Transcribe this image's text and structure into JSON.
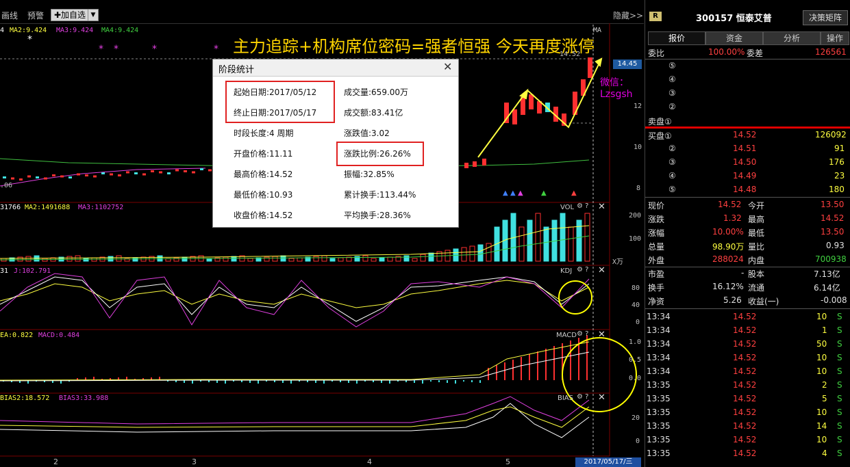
{
  "toolbar": {
    "draw_label": "画线",
    "alert_label": "预警",
    "add_watch_label": "✚加自选",
    "hide_label": "隐藏>>"
  },
  "banner_text": "主力追踪+机构席位密码=强者恒强  今天再度涨停",
  "wechat_text": "微信：Lzsgsh",
  "chart": {
    "ma_legend": [
      {
        "text": "4",
        "color": "#ffffff"
      },
      {
        "text": "MA2:9.424",
        "color": "#ffff40"
      },
      {
        "text": "MA3:9.424",
        "color": "#e040e0"
      },
      {
        "text": "MA4:9.424",
        "color": "#40d040"
      }
    ],
    "ma_short": "MA",
    "price_marker": "14.52",
    "price_tag": "14.45",
    "price_axis": [
      "12",
      "10",
      "8"
    ],
    "low_label": ".06",
    "vol_legend": [
      {
        "text": "31766",
        "color": "#ffffff"
      },
      {
        "text": "MA2:1491688",
        "color": "#ffff40"
      },
      {
        "text": "MA3:1102752",
        "color": "#e040e0"
      }
    ],
    "vol_name": "VOL",
    "vol_axis": [
      "200",
      "100"
    ],
    "vol_unit": "X万",
    "kdj_legend": [
      {
        "text": "31",
        "color": "#ffffff"
      },
      {
        "text": "J:102.791",
        "color": "#e040e0"
      }
    ],
    "kdj_name": "KDJ",
    "kdj_axis": [
      "80",
      "40",
      "0"
    ],
    "macd_legend": [
      {
        "text": "EA:0.822",
        "color": "#ffff40"
      },
      {
        "text": "MACD:0.484",
        "color": "#e040e0"
      }
    ],
    "macd_name": "MACD",
    "macd_axis": [
      "1.0",
      "0.5",
      "0.0"
    ],
    "bias_legend": [
      {
        "text": "BIAS2:18.572",
        "color": "#ffff40"
      },
      {
        "text": "BIAS3:33.988",
        "color": "#e040e0"
      }
    ],
    "bias_name": "BIAS",
    "bias_axis": [
      "20",
      "0"
    ],
    "x_labels": [
      "2",
      "3",
      "4",
      "5"
    ],
    "date_tag": "2017/05/17/三"
  },
  "dialog": {
    "title": "阶段统计",
    "start_date": "起始日期:2017/05/12",
    "end_date": "终止日期:2017/05/17",
    "period_len": "时段长度:4 周期",
    "open_price": "开盘价格:11.11",
    "high_price": "最高价格:14.52",
    "low_price": "最低价格:10.93",
    "close_price": "收盘价格:14.52",
    "volume": "成交量:659.00万",
    "amount": "成交额:83.41亿",
    "change_value": "涨跌值:3.02",
    "change_pct": "涨跌比例:26.26%",
    "amplitude": "振幅:32.85%",
    "cum_turnover": "累计换手:113.44%",
    "avg_turnover": "平均换手:28.36%"
  },
  "right_panel": {
    "badge": "R",
    "stock_title": "300157 恒泰艾普",
    "decision_btn": "决策矩阵",
    "tabs": [
      "报价",
      "资金",
      "分析",
      "操作"
    ],
    "commission_ratio_label": "委比",
    "commission_ratio": "100.00%",
    "commission_diff_label": "委差",
    "commission_diff": "126561",
    "sell_levels": [
      "⑤",
      "④",
      "③",
      "②",
      "卖盘①"
    ],
    "buy_levels": [
      {
        "label": "买盘①",
        "price": "14.52",
        "vol": "126092"
      },
      {
        "label": "②",
        "price": "14.51",
        "vol": "91"
      },
      {
        "label": "③",
        "price": "14.50",
        "vol": "176"
      },
      {
        "label": "④",
        "price": "14.49",
        "vol": "23"
      },
      {
        "label": "⑤",
        "price": "14.48",
        "vol": "180"
      }
    ],
    "quote": [
      {
        "l1": "现价",
        "v1": "14.52",
        "l2": "今开",
        "v2": "13.50"
      },
      {
        "l1": "涨跌",
        "v1": "1.32",
        "l2": "最高",
        "v2": "14.52"
      },
      {
        "l1": "涨幅",
        "v1": "10.00%",
        "l2": "最低",
        "v2": "13.50"
      },
      {
        "l1": "总量",
        "v1": "98.90万",
        "l2": "量比",
        "v2": "0.93"
      },
      {
        "l1": "外盘",
        "v1": "288024",
        "l2": "内盘",
        "v2": "700938"
      }
    ],
    "fund": [
      {
        "l1": "市盈",
        "v1": "-",
        "l2": "股本",
        "v2": "7.13亿"
      },
      {
        "l1": "换手",
        "v1": "16.12%",
        "l2": "流通",
        "v2": "6.14亿"
      },
      {
        "l1": "净资",
        "v1": "5.26",
        "l2": "收益(一)",
        "v2": "-0.008"
      }
    ],
    "ticks": [
      {
        "time": "13:34",
        "price": "14.52",
        "vol": "10",
        "side": "S"
      },
      {
        "time": "13:34",
        "price": "14.52",
        "vol": "1",
        "side": "S"
      },
      {
        "time": "13:34",
        "price": "14.52",
        "vol": "50",
        "side": "S"
      },
      {
        "time": "13:34",
        "price": "14.52",
        "vol": "10",
        "side": "S"
      },
      {
        "time": "13:34",
        "price": "14.52",
        "vol": "10",
        "side": "S"
      },
      {
        "time": "13:35",
        "price": "14.52",
        "vol": "2",
        "side": "S"
      },
      {
        "time": "13:35",
        "price": "14.52",
        "vol": "5",
        "side": "S"
      },
      {
        "time": "13:35",
        "price": "14.52",
        "vol": "10",
        "side": "S"
      },
      {
        "time": "13:35",
        "price": "14.52",
        "vol": "14",
        "side": "S"
      },
      {
        "time": "13:35",
        "price": "14.52",
        "vol": "10",
        "side": "S"
      },
      {
        "time": "13:35",
        "price": "14.52",
        "vol": "4",
        "side": "S"
      }
    ]
  }
}
